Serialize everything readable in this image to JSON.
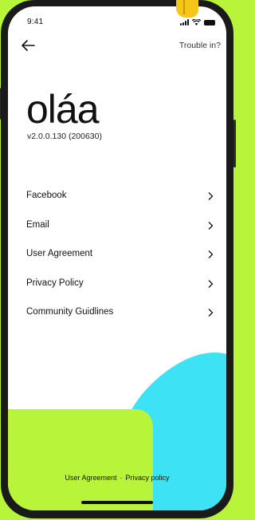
{
  "status": {
    "time": "9:41",
    "icons": [
      "signal-icon",
      "wifi-icon",
      "battery-icon"
    ]
  },
  "nav": {
    "back_icon": "back-arrow-icon",
    "trouble_label": "Trouble in?"
  },
  "brand": {
    "logo": "oláa",
    "version": "v2.0.0.130  (200630)"
  },
  "menu": {
    "items": [
      {
        "label": "Facebook"
      },
      {
        "label": "Email"
      },
      {
        "label": "User Agreement"
      },
      {
        "label": "Privacy Policy"
      },
      {
        "label": "Community Guidlines"
      }
    ],
    "chevron_icon": "chevron-right-icon"
  },
  "footer": {
    "user_agreement": "User Agreement",
    "separator": "·",
    "privacy_policy": "Privacy policy"
  },
  "colors": {
    "background": "#b8f53a",
    "accent_green": "#b8f53a",
    "accent_cyan": "#3de3f5",
    "text": "#111111"
  }
}
